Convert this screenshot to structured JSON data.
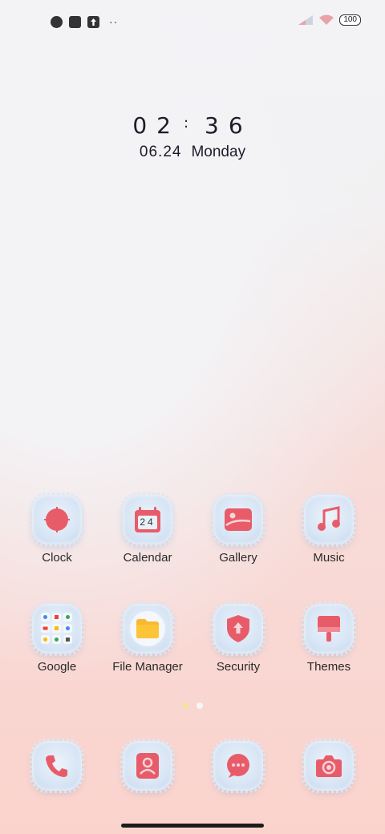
{
  "status_bar": {
    "battery": "100",
    "icons": [
      "app-icon",
      "square-icon",
      "upload-icon",
      "more-dots-icon",
      "signal-icon",
      "wifi-icon",
      "battery-icon"
    ],
    "more": "··"
  },
  "clock": {
    "hours": "02",
    "colon": ":",
    "minutes": "36",
    "date": "06.24",
    "weekday": "Monday"
  },
  "apps": [
    {
      "label": "Clock",
      "icon": "clock-icon"
    },
    {
      "label": "Calendar",
      "icon": "calendar-icon",
      "badge": "24"
    },
    {
      "label": "Gallery",
      "icon": "gallery-icon"
    },
    {
      "label": "Music",
      "icon": "music-icon"
    },
    {
      "label": "Google",
      "icon": "google-folder-icon"
    },
    {
      "label": "File Manager",
      "icon": "folder-icon"
    },
    {
      "label": "Security",
      "icon": "shield-icon"
    },
    {
      "label": "Themes",
      "icon": "themes-icon"
    }
  ],
  "dock": [
    {
      "icon": "phone-icon"
    },
    {
      "icon": "contacts-icon"
    },
    {
      "icon": "messages-icon"
    },
    {
      "icon": "camera-icon"
    }
  ],
  "colors": {
    "accent": "#e85c6a",
    "icon_base": "#d9e6f5"
  }
}
